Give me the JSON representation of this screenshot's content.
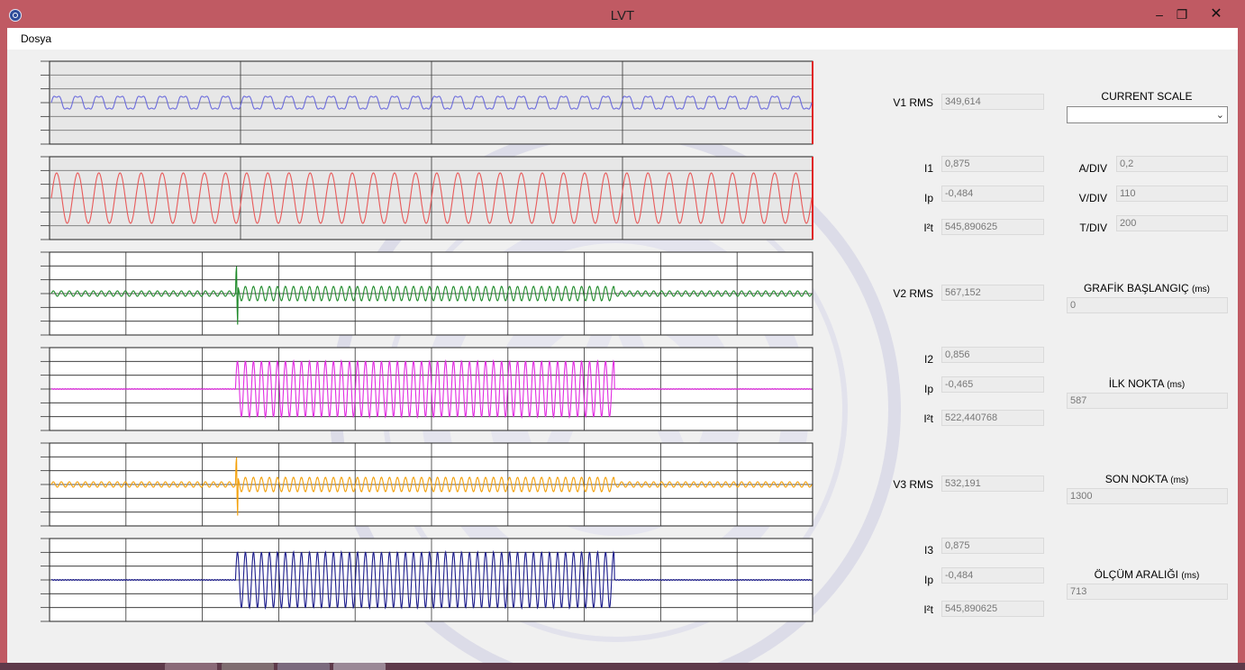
{
  "window": {
    "title": "LVT"
  },
  "window_controls": {
    "minimize": "–",
    "maximize": "❐",
    "close": "✕"
  },
  "menu": {
    "file_label": "Dosya"
  },
  "charts": [
    {
      "name": "v1-plot",
      "color": "#6b6bdc",
      "bg": "#e7e7e7",
      "vdivs": 4,
      "redEdge": true,
      "waveform": "v1",
      "cycles": 36,
      "event": [
        0,
        0
      ]
    },
    {
      "name": "i1-plot",
      "color": "#e85a5a",
      "bg": "#e7e7e7",
      "vdivs": 4,
      "redEdge": true,
      "waveform": "i1",
      "cycles": 36,
      "event": [
        0,
        0
      ]
    },
    {
      "name": "v2-plot",
      "color": "#1f8a2a",
      "bg": "#ffffff",
      "vdivs": 10,
      "redEdge": false,
      "waveform": "v2",
      "cycles": 95,
      "event": [
        0.2425,
        0.74
      ]
    },
    {
      "name": "i2-plot",
      "color": "#e22be2",
      "bg": "#ffffff",
      "vdivs": 10,
      "redEdge": false,
      "waveform": "i",
      "cycles": 95,
      "event": [
        0.2425,
        0.74
      ]
    },
    {
      "name": "v3-plot",
      "color": "#f4a10b",
      "bg": "#ffffff",
      "vdivs": 10,
      "redEdge": false,
      "waveform": "v3",
      "cycles": 95,
      "event": [
        0.2425,
        0.74
      ]
    },
    {
      "name": "i3-plot",
      "color": "#1c1c8c",
      "bg": "#ffffff",
      "vdivs": 10,
      "redEdge": false,
      "waveform": "i",
      "cycles": 95,
      "event": [
        0.2425,
        0.74
      ]
    }
  ],
  "measurements": {
    "v1": {
      "label": "V1 RMS",
      "value": "349,614"
    },
    "i1": {
      "label": "I1",
      "value": "0,875"
    },
    "ip1": {
      "label": "Ip",
      "value": "-0,484"
    },
    "i2t1": {
      "label": "I²t",
      "value": "545,890625"
    },
    "v2": {
      "label": "V2 RMS",
      "value": "567,152"
    },
    "i2": {
      "label": "I2",
      "value": "0,856"
    },
    "ip2": {
      "label": "Ip",
      "value": "-0,465"
    },
    "i2t2": {
      "label": "I²t",
      "value": "522,440768"
    },
    "v3": {
      "label": "V3 RMS",
      "value": "532,191"
    },
    "i3": {
      "label": "I3",
      "value": "0,875"
    },
    "ip3": {
      "label": "Ip",
      "value": "-0,484"
    },
    "i2t3": {
      "label": "I²t",
      "value": "545,890625"
    }
  },
  "settings": {
    "current_scale": {
      "label": "CURRENT SCALE",
      "selected": ""
    },
    "a_div": {
      "label": "A/DIV",
      "value": "0,2"
    },
    "v_div": {
      "label": "V/DIV",
      "value": "110"
    },
    "t_div": {
      "label": "T/DIV",
      "value": "200"
    },
    "grafik_baslangic": {
      "label": "GRAFİK BAŞLANGIÇ",
      "unit": "(ms)",
      "value": "0"
    },
    "ilk_nokta": {
      "label": "İLK NOKTA",
      "unit": "(ms)",
      "value": "587"
    },
    "son_nokta": {
      "label": "SON NOKTA",
      "unit": "(ms)",
      "value": "1300"
    },
    "olcum_araligi": {
      "label": "ÖLÇÜM ARALIĞI",
      "unit": "(ms)",
      "value": "713"
    }
  }
}
